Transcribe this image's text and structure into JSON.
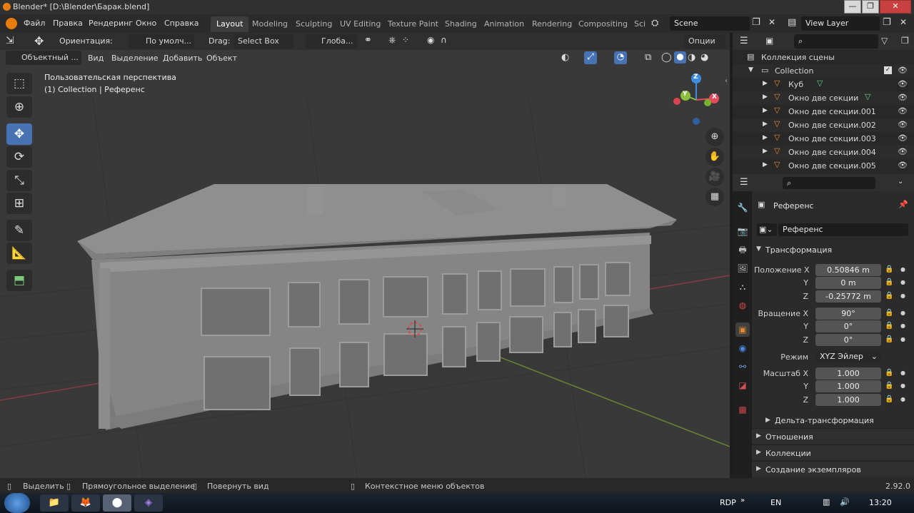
{
  "titlebar": {
    "title": "Blender* [D:\\Blender\\Барак.blend]",
    "min": "—",
    "max": "❐",
    "close": "✕"
  },
  "menu": [
    "Файл",
    "Правка",
    "Рендеринг",
    "Окно",
    "Справка"
  ],
  "workspaces": [
    "Layout",
    "Modeling",
    "Sculpting",
    "UV Editing",
    "Texture Paint",
    "Shading",
    "Animation",
    "Rendering",
    "Compositing",
    "Sci"
  ],
  "scene": {
    "label": "Scene"
  },
  "view_layer": {
    "label": "View Layer"
  },
  "tool_header": {
    "orientation_label": "Ориентация:",
    "orientation_value": "По умолч...",
    "drag_label": "Drag:",
    "drag_value": "Select Box",
    "transform_value": "Глоба...",
    "options": "Опции"
  },
  "viewport_header": {
    "mode": "Объектный ...",
    "menus": [
      "Вид",
      "Выделение",
      "Добавить",
      "Объект"
    ]
  },
  "viewport": {
    "view_name": "Пользовательская перспектива",
    "context": "(1) Collection | Референс",
    "gizmo": {
      "x": "X",
      "y": "Y",
      "z": "Z"
    }
  },
  "outliner": {
    "scene_collection": "Коллекция сцены",
    "collection": "Collection",
    "items": [
      "Куб",
      "Окно две секции",
      "Окно две секции.001",
      "Окно две секции.002",
      "Окно две секции.003",
      "Окно две секции.004",
      "Окно две секции.005"
    ]
  },
  "properties": {
    "object_name": "Референс",
    "name_field": "Референс",
    "transform_header": "Трансформация",
    "location": {
      "label": "Положение X",
      "x": "0.50846 m",
      "y": "0 m",
      "z": "-0.25772 m"
    },
    "rotation": {
      "label": "Вращение X",
      "x": "90°",
      "y": "0°",
      "z": "0°"
    },
    "mode_label": "Режим",
    "mode_value": "XYZ Эйлер",
    "scale": {
      "label": "Масштаб X",
      "x": "1.000",
      "y": "1.000",
      "z": "1.000"
    },
    "axis_y": "Y",
    "axis_z": "Z",
    "delta": "Дельта-трансформация",
    "sections": [
      "Отношения",
      "Коллекции",
      "Создание экземпляров"
    ]
  },
  "statusbar": {
    "select": "Выделить",
    "box_select": "Прямоугольное выделение",
    "rotate": "Повернуть вид",
    "context_menu": "Контекстное меню объектов",
    "version": "2.92.0"
  },
  "taskbar": {
    "rdp": "RDP",
    "lang": "EN",
    "time": "13:20"
  },
  "colors": {
    "accent": "#4772b3",
    "object_orange": "#e38a2a",
    "axis_x": "#e44a5a",
    "axis_y": "#8bbf3f",
    "axis_z": "#3d8ce0"
  }
}
